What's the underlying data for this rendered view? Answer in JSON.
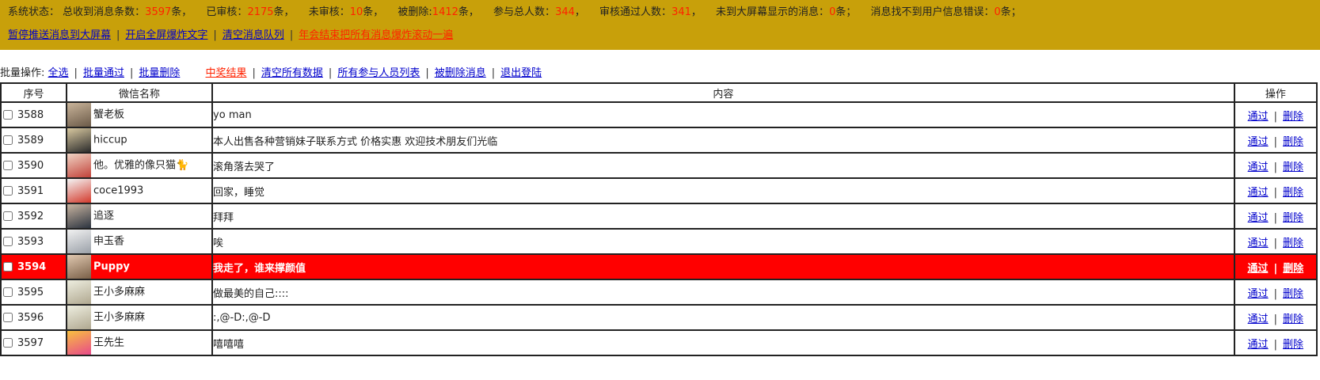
{
  "status": {
    "label": "系统状态：",
    "total_label": "总收到消息条数：",
    "total": "3597",
    "total_unit": "条，",
    "reviewed_label": "已审核：",
    "reviewed": "2175",
    "reviewed_unit": "条，",
    "unreviewed_label": "未审核：",
    "unreviewed": "10",
    "unreviewed_unit": "条，",
    "deleted_label": "被删除:",
    "deleted": "1412",
    "deleted_unit": "条，",
    "participants_label": "参与总人数：",
    "participants": "344",
    "participants_unit": "，",
    "approved_people_label": "审核通过人数：",
    "approved_people": "341",
    "approved_people_unit": "，",
    "not_shown_label": "未到大屏幕显示的消息：",
    "not_shown": "0",
    "not_shown_unit": "条；",
    "user_err_label": "消息找不到用户信息错误：",
    "user_err": "0",
    "user_err_unit": "条；"
  },
  "actions": {
    "pause_push": "暂停推送消息到大屏幕",
    "fullscreen_text": "开启全屏爆炸文字",
    "clear_queue": "清空消息队列",
    "year_end": "年会结束把所有消息爆炸滚动一遍"
  },
  "batch": {
    "label": "批量操作:",
    "select_all": "全选",
    "batch_approve": "批量通过",
    "batch_delete": "批量删除",
    "winners": "中奖结果",
    "clear_all": "清空所有数据",
    "participants_list": "所有参与人员列表",
    "deleted_msgs": "被删除消息",
    "logout": "退出登陆"
  },
  "table": {
    "headers": {
      "id": "序号",
      "name": "微信名称",
      "content": "内容",
      "ops": "操作"
    },
    "approve": "通过",
    "delete": "删除",
    "rows": [
      {
        "id": "3588",
        "name": "蟹老板",
        "content": "yo man",
        "highlight": false,
        "avatar": [
          "#6b5a48",
          "#c9b49a"
        ]
      },
      {
        "id": "3589",
        "name": "hiccup",
        "content": "本人出售各种营销妹子联系方式 价格实惠 欢迎技术朋友们光临",
        "highlight": false,
        "avatar": [
          "#2b2b2b",
          "#d8c8a0"
        ]
      },
      {
        "id": "3590",
        "name": "他。优雅的像只猫🐈",
        "content": "滚角落去哭了",
        "highlight": false,
        "avatar": [
          "#c2423a",
          "#f0d4c4"
        ]
      },
      {
        "id": "3591",
        "name": "coce1993",
        "content": "回家，睡觉",
        "highlight": false,
        "avatar": [
          "#d33a2c",
          "#f4f4f4"
        ]
      },
      {
        "id": "3592",
        "name": "追逐",
        "content": "拜拜",
        "highlight": false,
        "avatar": [
          "#2c3440",
          "#c8b4a0"
        ]
      },
      {
        "id": "3593",
        "name": "申玉香",
        "content": "唉",
        "highlight": false,
        "avatar": [
          "#9aa0a8",
          "#f2f2f2"
        ]
      },
      {
        "id": "3594",
        "name": "Puppy",
        "content": "我走了，谁来撑颜值",
        "highlight": true,
        "avatar": [
          "#7a6048",
          "#e0c8b0"
        ]
      },
      {
        "id": "3595",
        "name": "王小多麻麻",
        "content": "做最美的自己::::",
        "highlight": false,
        "avatar": [
          "#b0a890",
          "#eeeee0"
        ]
      },
      {
        "id": "3596",
        "name": "王小多麻麻",
        "content": ":,@-D:,@-D",
        "highlight": false,
        "avatar": [
          "#b0a890",
          "#eeeee0"
        ]
      },
      {
        "id": "3597",
        "name": "王先生",
        "content": "嘻嘻嘻",
        "highlight": false,
        "avatar": [
          "#e84a8a",
          "#f8c040"
        ]
      }
    ]
  }
}
